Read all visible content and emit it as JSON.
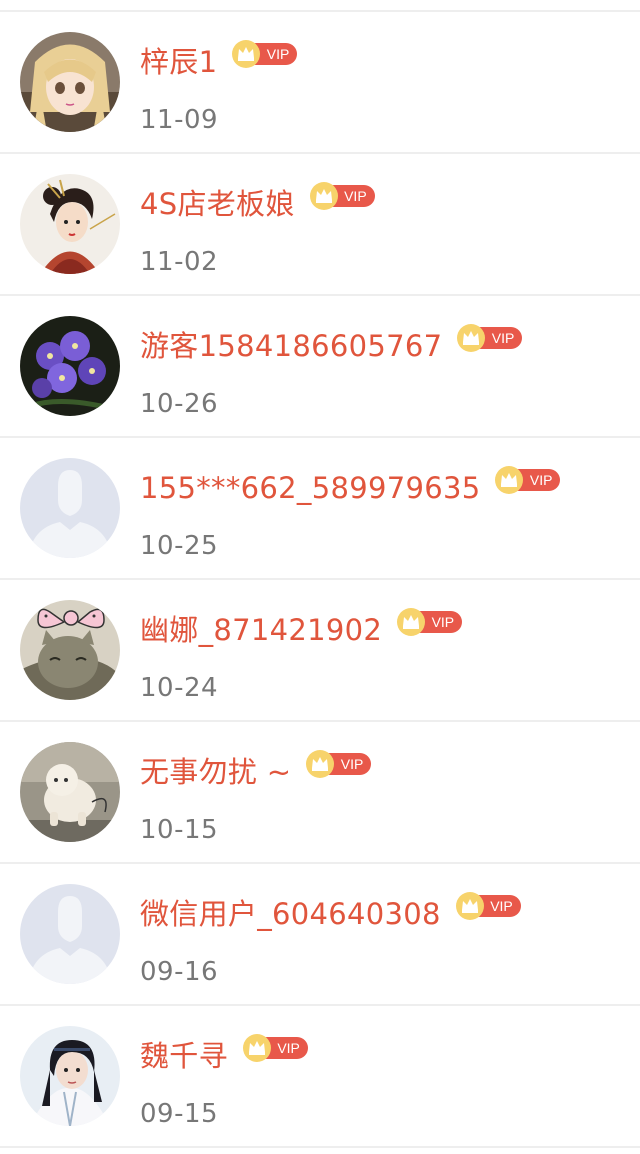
{
  "vip_label": "VIP",
  "colors": {
    "name": "#e0553c",
    "date": "#777777",
    "vip_badge": "#e8584a",
    "crown": "#f5c542",
    "divider": "#eeeeee"
  },
  "users": [
    {
      "name": "梓辰1",
      "date": "11-09",
      "avatar": "anime-girl-blonde"
    },
    {
      "name": "4S店老板娘",
      "date": "11-02",
      "avatar": "painted-lady"
    },
    {
      "name": "游客1584186605767",
      "date": "10-26",
      "avatar": "purple-flowers"
    },
    {
      "name": "155***662_589979635",
      "date": "10-25",
      "avatar": "default-person"
    },
    {
      "name": "幽娜_871421902",
      "date": "10-24",
      "avatar": "cat-with-bow"
    },
    {
      "name": "无事勿扰 ~",
      "date": "10-15",
      "avatar": "white-puppy"
    },
    {
      "name": "微信用户_604640308",
      "date": "09-16",
      "avatar": "default-person"
    },
    {
      "name": "魏千寻",
      "date": "09-15",
      "avatar": "costume-man"
    }
  ]
}
